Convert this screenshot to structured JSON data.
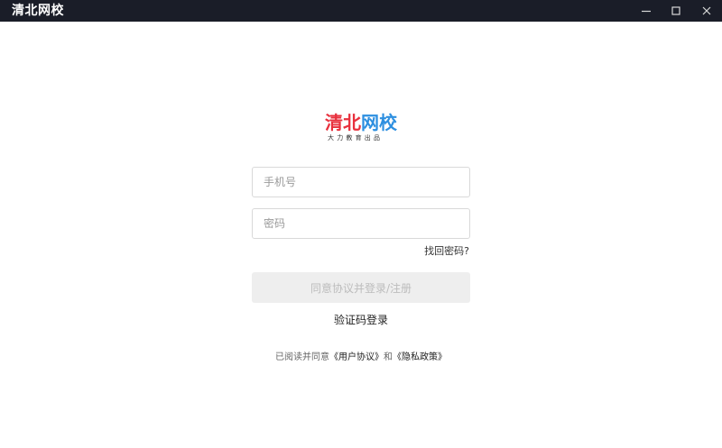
{
  "window": {
    "title": "清北网校",
    "controls": {
      "minimize_icon": "minimize-icon",
      "maximize_icon": "maximize-icon",
      "close_icon": "close-icon"
    }
  },
  "logo": {
    "text_red": "清北",
    "text_blue": "网校",
    "tagline": "大力教育出品",
    "colors": {
      "red": "#e8303d",
      "blue": "#2d8fe0"
    }
  },
  "form": {
    "phone_placeholder": "手机号",
    "password_placeholder": "密码",
    "phone_value": "",
    "password_value": "",
    "forgot_label": "找回密码?",
    "submit_label": "同意协议并登录/注册",
    "code_login_label": "验证码登录"
  },
  "agreement": {
    "prefix": "已阅读并同意",
    "user_agreement": "《用户协议》",
    "conjunction": "和",
    "privacy_policy": "《隐私政策》"
  }
}
